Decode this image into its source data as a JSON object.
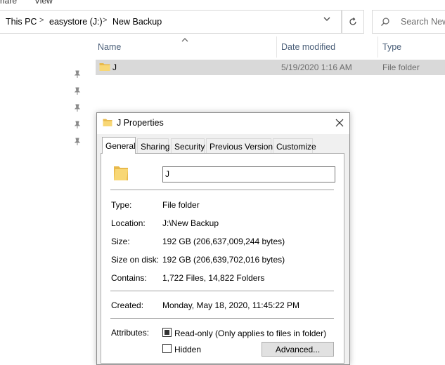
{
  "ribbon": {
    "share_label": "hare",
    "view_label": "View"
  },
  "address_bar": {
    "crumbs": [
      "This PC",
      "easystore (J:)",
      "New Backup"
    ],
    "separator": ">"
  },
  "search": {
    "placeholder": "Search New"
  },
  "file_list": {
    "columns": {
      "name": "Name",
      "date_modified": "Date modified",
      "type": "Type"
    },
    "rows": [
      {
        "name": "J",
        "date_modified": "5/19/2020 1:16 AM",
        "type": "File folder"
      }
    ]
  },
  "properties_dialog": {
    "title": "J Properties",
    "tabs": [
      "General",
      "Sharing",
      "Security",
      "Previous Versions",
      "Customize"
    ],
    "active_tab": "General",
    "name_value": "J",
    "fields": {
      "type": {
        "label": "Type:",
        "value": "File folder"
      },
      "location": {
        "label": "Location:",
        "value": "J:\\New Backup"
      },
      "size": {
        "label": "Size:",
        "value": "192 GB (206,637,009,244 bytes)"
      },
      "size_on_disk": {
        "label": "Size on disk:",
        "value": "192 GB (206,639,702,016 bytes)"
      },
      "contains": {
        "label": "Contains:",
        "value": "1,722 Files, 14,822 Folders"
      },
      "created": {
        "label": "Created:",
        "value": "Monday, May 18, 2020, 11:45:22 PM"
      }
    },
    "attributes": {
      "label": "Attributes:",
      "read_only": {
        "label": "Read-only (Only applies to files in folder)",
        "state": "indeterminate"
      },
      "hidden": {
        "label": "Hidden",
        "state": "unchecked"
      },
      "advanced_button": "Advanced..."
    }
  },
  "colors": {
    "selected_row": "#d9d9d9",
    "column_header_text": "#4c607a",
    "folder_yellow": "#f8d775",
    "dialog_bg": "#f0f0f0"
  }
}
